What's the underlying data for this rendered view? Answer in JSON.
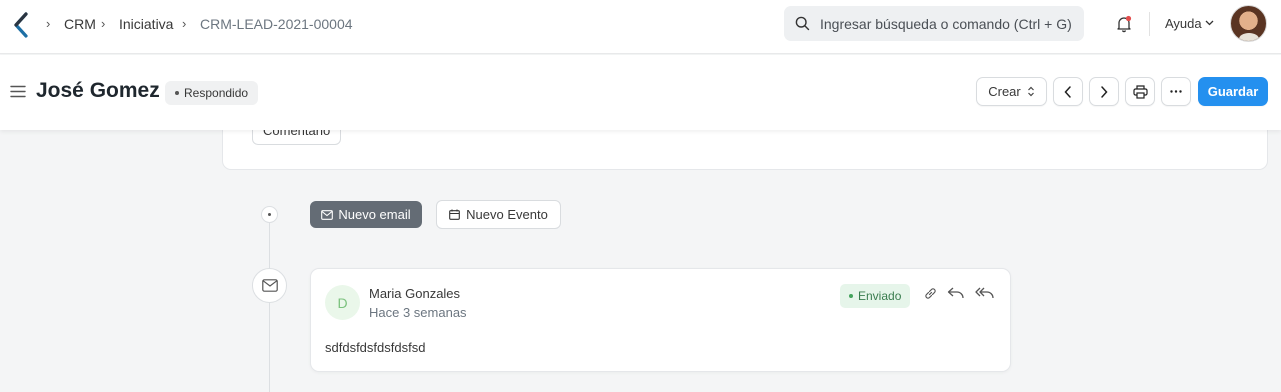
{
  "navbar": {
    "breadcrumbs": [
      "CRM",
      "Iniciativa",
      "CRM-LEAD-2021-00004"
    ],
    "search_placeholder": "Ingresar búsqueda o comando (Ctrl + G)",
    "help_label": "Ayuda"
  },
  "page": {
    "title": "José Gomez",
    "status": "Respondido",
    "create_label": "Crear",
    "save_label": "Guardar"
  },
  "comment_label": "Comentario",
  "timeline": {
    "new_email_label": "Nuevo email",
    "new_event_label": "Nuevo Evento"
  },
  "email": {
    "avatar_initial": "D",
    "sender": "Maria Gonzales",
    "time": "Hace 3 semanas",
    "status": "Enviado",
    "body": "sdfdsfdsfdsfdsfsd"
  },
  "colors": {
    "primary": "#2490ef",
    "sent_bg": "#e6f5ea",
    "sent_text": "#3a7d4f"
  }
}
